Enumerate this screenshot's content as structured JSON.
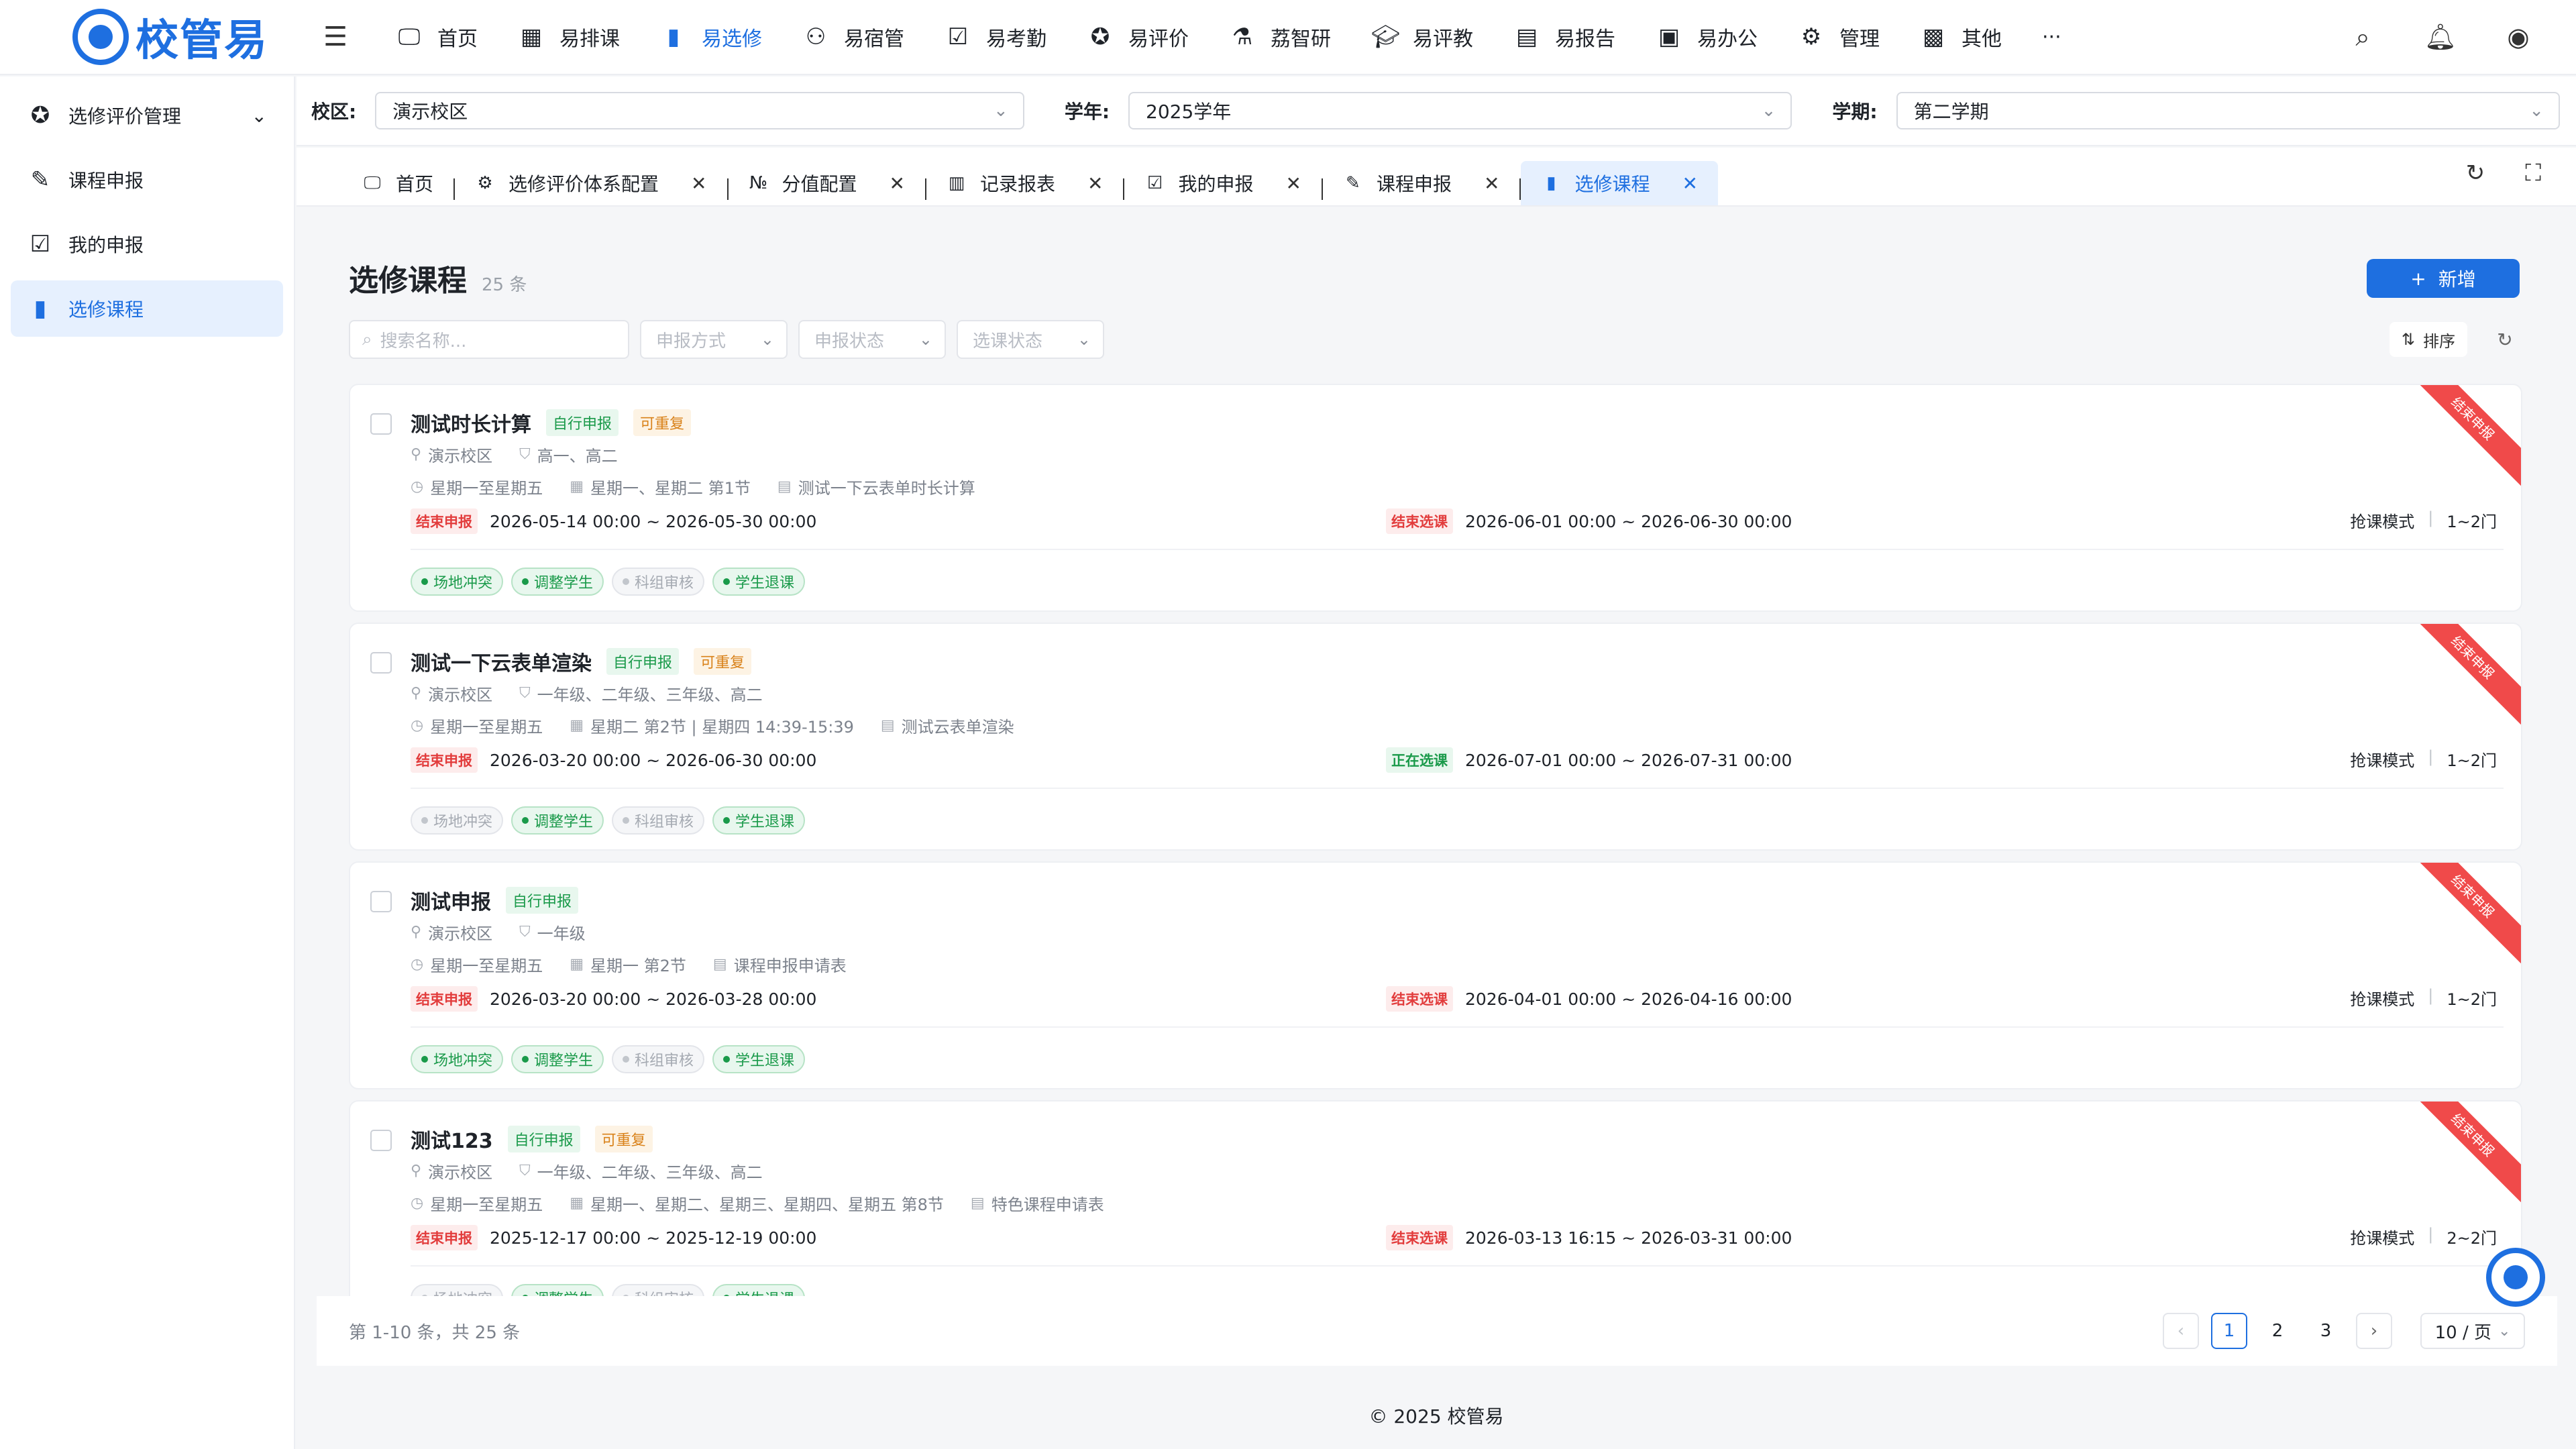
{
  "app": {
    "name": "校管易"
  },
  "topnav": {
    "items": [
      {
        "label": "首页",
        "icon": "monitor-icon"
      },
      {
        "label": "易排课",
        "icon": "calendar-icon"
      },
      {
        "label": "易选修",
        "icon": "book-icon",
        "active": true
      },
      {
        "label": "易宿管",
        "icon": "people-icon"
      },
      {
        "label": "易考勤",
        "icon": "check-calendar-icon"
      },
      {
        "label": "易评价",
        "icon": "star-icon"
      },
      {
        "label": "荔智研",
        "icon": "research-icon"
      },
      {
        "label": "易评教",
        "icon": "graduation-icon"
      },
      {
        "label": "易报告",
        "icon": "report-icon"
      },
      {
        "label": "易办公",
        "icon": "briefcase-icon"
      },
      {
        "label": "管理",
        "icon": "gear-icon"
      },
      {
        "label": "其他",
        "icon": "grid-icon"
      }
    ],
    "more": "···"
  },
  "sidebar": {
    "items": [
      {
        "label": "选修评价管理",
        "icon": "star-circle-icon"
      },
      {
        "label": "课程申报",
        "icon": "edit-doc-icon"
      },
      {
        "label": "我的申报",
        "icon": "check-doc-icon"
      },
      {
        "label": "选修课程",
        "icon": "book-icon",
        "active": true
      }
    ]
  },
  "filters": {
    "campus_label": "校区:",
    "campus_value": "演示校区",
    "year_label": "学年:",
    "year_value": "2025学年",
    "term_label": "学期:",
    "term_value": "第二学期"
  },
  "tabs": [
    {
      "label": "首页",
      "icon": "monitor-icon",
      "closable": false
    },
    {
      "label": "选修评价体系配置",
      "icon": "gear-icon",
      "closable": true
    },
    {
      "label": "分值配置",
      "icon": "123-icon",
      "closable": true
    },
    {
      "label": "记录报表",
      "icon": "bar-chart-icon",
      "closable": true
    },
    {
      "label": "我的申报",
      "icon": "check-doc-icon",
      "closable": true
    },
    {
      "label": "课程申报",
      "icon": "edit-doc-icon",
      "closable": true
    },
    {
      "label": "选修课程",
      "icon": "book-icon",
      "closable": true,
      "active": true
    }
  ],
  "page": {
    "title": "选修课程",
    "count": "25 条",
    "add_label": "新增",
    "search_placeholder": "搜索名称...",
    "filter_declare_mode": "申报方式",
    "filter_declare_status": "申报状态",
    "filter_select_status": "选课状态",
    "sort_label": "排序"
  },
  "courses": [
    {
      "title": "测试时长计算",
      "tags": [
        "自行申报",
        "可重复"
      ],
      "campus": "演示校区",
      "grades": "高一、高二",
      "days": "星期一至星期五",
      "schedule": "星期一、星期二 第1节",
      "form": "测试一下云表单时长计算",
      "declare_status": "结束申报",
      "declare_period": "2026-05-14 00:00 ~ 2026-05-30 00:00",
      "select_status": "结束选课",
      "select_status_color": "red",
      "select_period": "2026-06-01 00:00 ~ 2026-06-30 00:00",
      "mode": "抢课模式",
      "limit": "1~2门",
      "ribbon": "结束申报",
      "chips": [
        {
          "label": "场地冲突",
          "on": true
        },
        {
          "label": "调整学生",
          "on": true
        },
        {
          "label": "科组审核",
          "on": false
        },
        {
          "label": "学生退课",
          "on": true
        }
      ]
    },
    {
      "title": "测试一下云表单渲染",
      "tags": [
        "自行申报",
        "可重复"
      ],
      "campus": "演示校区",
      "grades": "一年级、二年级、三年级、高二",
      "days": "星期一至星期五",
      "schedule": "星期二 第2节 | 星期四 14:39-15:39",
      "form": "测试云表单渲染",
      "declare_status": "结束申报",
      "declare_period": "2026-03-20 00:00 ~ 2026-06-30 00:00",
      "select_status": "正在选课",
      "select_status_color": "green",
      "select_period": "2026-07-01 00:00 ~ 2026-07-31 00:00",
      "mode": "抢课模式",
      "limit": "1~2门",
      "ribbon": "结束申报",
      "chips": [
        {
          "label": "场地冲突",
          "on": false
        },
        {
          "label": "调整学生",
          "on": true
        },
        {
          "label": "科组审核",
          "on": false
        },
        {
          "label": "学生退课",
          "on": true
        }
      ]
    },
    {
      "title": "测试申报",
      "tags": [
        "自行申报"
      ],
      "campus": "演示校区",
      "grades": "一年级",
      "days": "星期一至星期五",
      "schedule": "星期一 第2节",
      "form": "课程申报申请表",
      "declare_status": "结束申报",
      "declare_period": "2026-03-20 00:00 ~ 2026-03-28 00:00",
      "select_status": "结束选课",
      "select_status_color": "red",
      "select_period": "2026-04-01 00:00 ~ 2026-04-16 00:00",
      "mode": "抢课模式",
      "limit": "1~2门",
      "ribbon": "结束申报",
      "chips": [
        {
          "label": "场地冲突",
          "on": true
        },
        {
          "label": "调整学生",
          "on": true
        },
        {
          "label": "科组审核",
          "on": false
        },
        {
          "label": "学生退课",
          "on": true
        }
      ]
    },
    {
      "title": "测试123",
      "tags": [
        "自行申报",
        "可重复"
      ],
      "campus": "演示校区",
      "grades": "一年级、二年级、三年级、高二",
      "days": "星期一至星期五",
      "schedule": "星期一、星期二、星期三、星期四、星期五 第8节",
      "form": "特色课程申请表",
      "declare_status": "结束申报",
      "declare_period": "2025-12-17 00:00 ~ 2025-12-19 00:00",
      "select_status": "结束选课",
      "select_status_color": "red",
      "select_period": "2026-03-13 16:15 ~ 2026-03-31 00:00",
      "mode": "抢课模式",
      "limit": "2~2门",
      "ribbon": "结束申报",
      "chips": [
        {
          "label": "场地冲突",
          "on": false
        },
        {
          "label": "调整学生",
          "on": true
        },
        {
          "label": "科组审核",
          "on": false
        },
        {
          "label": "学生退课",
          "on": true
        }
      ]
    }
  ],
  "pagination": {
    "info": "第 1-10 条，共 25 条",
    "pages": [
      "1",
      "2",
      "3"
    ],
    "current": "1",
    "page_size": "10 / 页"
  },
  "footer": "© 2025 校管易"
}
